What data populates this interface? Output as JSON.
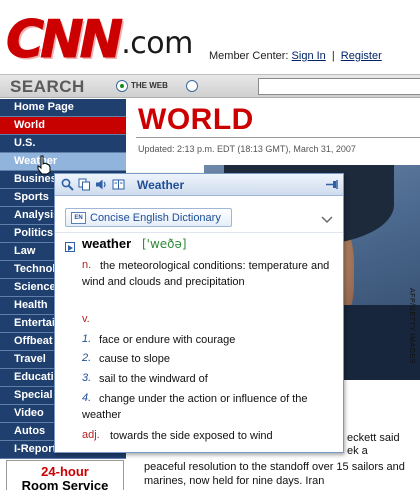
{
  "header": {
    "logo_cnn": "CNN",
    "logo_dotcom": ".com",
    "member_center": "Member Center:",
    "sign_in": "Sign In",
    "separator": "|",
    "register": "Register"
  },
  "search": {
    "label": "SEARCH",
    "option_web": "THE WEB",
    "input_value": ""
  },
  "nav": {
    "items": [
      {
        "label": "Home Page"
      },
      {
        "label": "World"
      },
      {
        "label": "U.S."
      },
      {
        "label": "Weather"
      },
      {
        "label": "Business"
      },
      {
        "label": "Sports"
      },
      {
        "label": "Analysis"
      },
      {
        "label": "Politics"
      },
      {
        "label": "Law"
      },
      {
        "label": "Technology"
      },
      {
        "label": "Science"
      },
      {
        "label": "Health"
      },
      {
        "label": "Entertainment"
      },
      {
        "label": "Offbeat"
      },
      {
        "label": "Travel"
      },
      {
        "label": "Education"
      },
      {
        "label": "Special Reports"
      },
      {
        "label": "Video"
      },
      {
        "label": "Autos"
      },
      {
        "label": "I-Reports"
      }
    ],
    "promo_line1": "24-hour",
    "promo_line2": "Room Service"
  },
  "main": {
    "section_title": "WORLD",
    "updated": "Updated: 2:13 p.m. EDT (18:13 GMT), March 31, 2007",
    "photo_credit": "AFP/GETTY IMAGES",
    "article_line1": "eckett said",
    "article_line2": "ek a",
    "article_bottom": "peaceful resolution to the standoff over 15 sailors and marines, now held for nine days. Iran"
  },
  "dictionary": {
    "title": "Weather",
    "source": "Concise English Dictionary",
    "headword": "weather",
    "phonetic": "['weðə]",
    "senses": [
      {
        "pos": "n.",
        "text": "the meteorological conditions: temperature and wind and clouds and precipitation"
      },
      {
        "pos": "v.",
        "num": "1.",
        "text": "face or endure with courage"
      },
      {
        "num": "2.",
        "text": "cause to slope"
      },
      {
        "num": "3.",
        "text": "sail to the windward of"
      },
      {
        "num": "4.",
        "text": "change under the action or influence of the weather"
      },
      {
        "pos": "adj.",
        "text": "towards the side exposed to wind"
      }
    ]
  },
  "colors": {
    "cnn_red": "#cc0000",
    "nav_blue": "#1f3f6f",
    "nav_hover": "#90b4dc",
    "dict_accent": "#1f4f96"
  }
}
